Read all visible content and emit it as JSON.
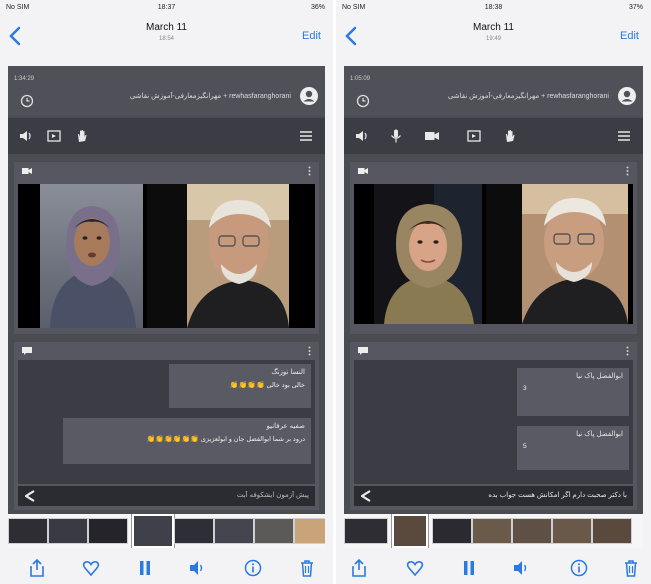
{
  "left": {
    "status": {
      "carrier": "No SIM",
      "time": "18:37",
      "battery": "36%"
    },
    "nav": {
      "title": "March 11",
      "subtitle": "18:54",
      "edit": "Edit"
    },
    "recording": {
      "time": "1:34:29",
      "title": "مهرانگیزمعارفی-آموزش نقاشی + rewhasfaranghorani"
    },
    "chat": {
      "messages": [
        {
          "sender": "النسا نوزنگ",
          "body": "خالی بود خالی",
          "emoji": "👏👏👏👏"
        },
        {
          "sender": "صفیه عرفانیو",
          "body": "درود بر شما ابوالفضل جان و ابولعزیزی",
          "emoji": "👏👏👏👏👏👏"
        }
      ],
      "input": "پیش آزمون ایشکوفه آبت"
    }
  },
  "right": {
    "status": {
      "carrier": "No SIM",
      "time": "18:38",
      "battery": "37%"
    },
    "nav": {
      "title": "March 11",
      "subtitle": "19:49",
      "edit": "Edit"
    },
    "recording": {
      "time": "1:05:09",
      "title": "مهرانگیزمعارفی-آموزش نقاشی + rewhasfaranghorani"
    },
    "chat": {
      "messages": [
        {
          "sender": "ابوالفضل پاک نیا",
          "body": "3"
        },
        {
          "sender": "ابوالفضل پاک نیا",
          "body": "5"
        }
      ],
      "input": "با دکتر صحبت دارم اگر امکانش هست جواب بده"
    }
  },
  "icons": {
    "bottom": [
      "share-icon",
      "heart-icon",
      "pause-icon",
      "volume-icon",
      "info-icon",
      "trash-icon"
    ],
    "toolbar_left": [
      "speaker-icon",
      "screen-share-icon",
      "hand-icon"
    ],
    "toolbar_right": [
      "speaker-icon",
      "microphone-icon",
      "camera-icon",
      "screen-share-icon",
      "hand-icon"
    ]
  },
  "colors": {
    "accent": "#2a7ae2",
    "panel": "#4b4b52",
    "dark": "#3c3c44",
    "emoji": "#f0b030"
  }
}
